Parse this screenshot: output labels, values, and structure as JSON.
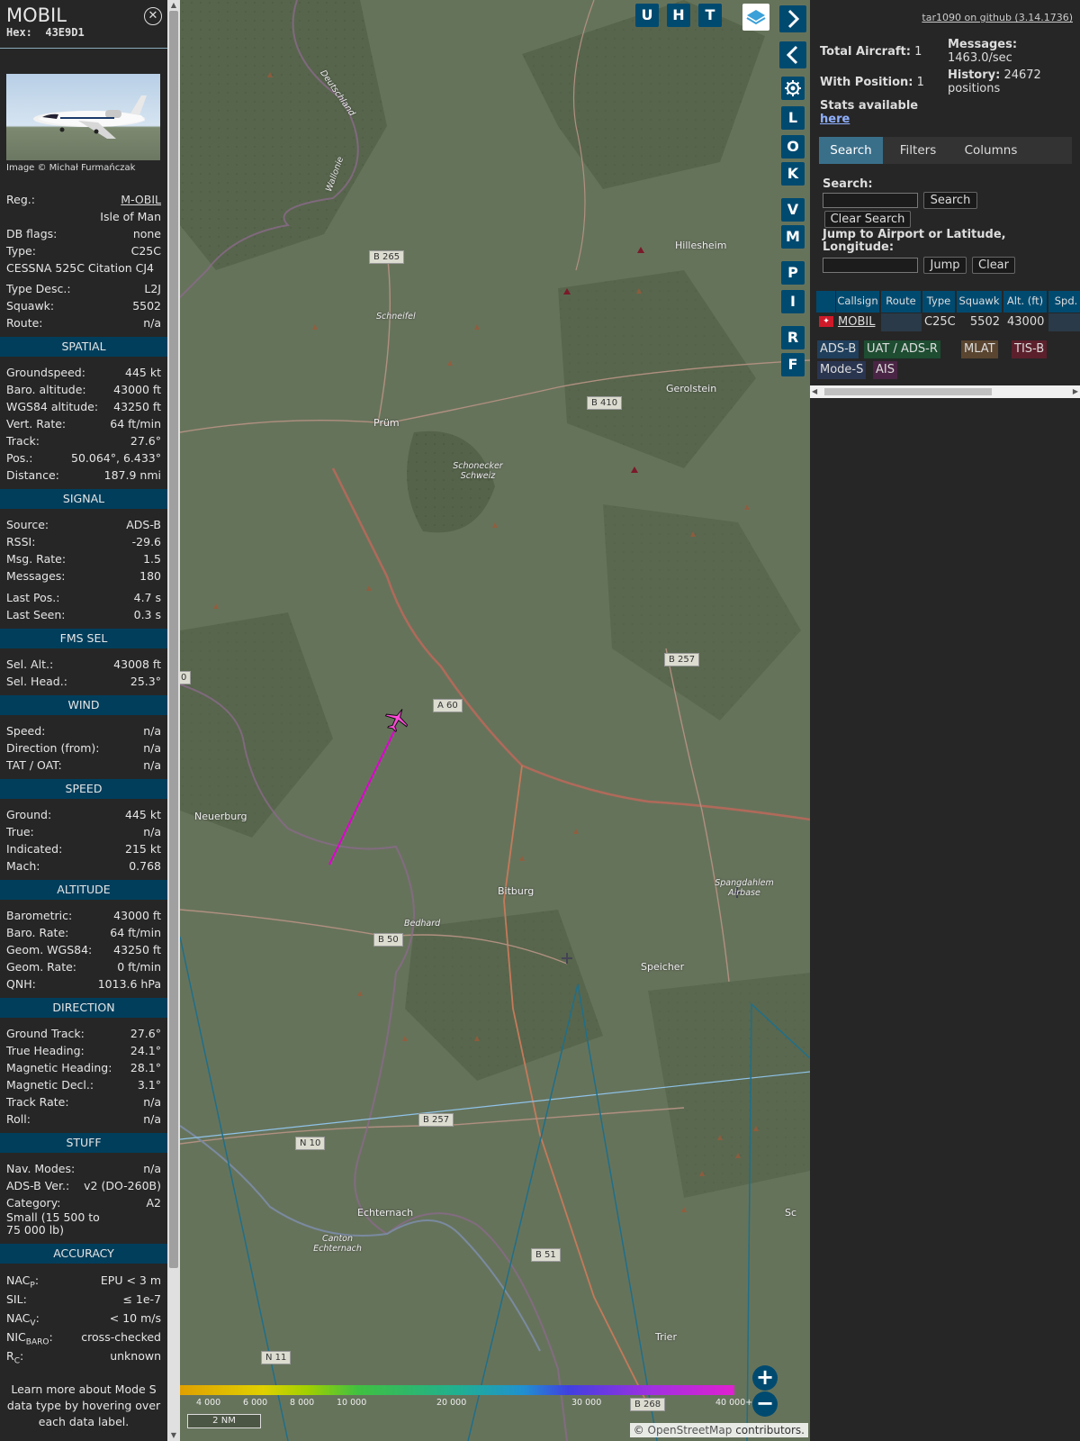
{
  "sidebar": {
    "callsign": "MOBIL",
    "hex_label": "Hex:",
    "hex": "43E9D1",
    "close_icon": "close-icon",
    "photo_credit": "Image © Michał Furmańczak",
    "info": [
      {
        "k": "Reg.:",
        "v": "M-OBIL"
      },
      {
        "k": "",
        "v": "Isle of Man"
      },
      {
        "k": "DB flags:",
        "v": "none"
      },
      {
        "k": "Type:",
        "v": "C25C"
      },
      {
        "k": "CESSNA 525C Citation CJ4",
        "v": ""
      },
      {
        "k": "Type Desc.:",
        "v": "L2J"
      },
      {
        "k": "Squawk:",
        "v": "5502"
      },
      {
        "k": "Route:",
        "v": "n/a"
      }
    ],
    "sections": [
      {
        "title": "SPATIAL",
        "rows": [
          {
            "k": "Groundspeed:",
            "v": "445 kt"
          },
          {
            "k": "Baro. altitude:",
            "v": "43000 ft"
          },
          {
            "k": "WGS84 altitude:",
            "v": "43250 ft"
          },
          {
            "k": "Vert. Rate:",
            "v": "64 ft/min"
          },
          {
            "k": "Track:",
            "v": "27.6°"
          },
          {
            "k": "Pos.:",
            "v": "50.064°, 6.433°"
          },
          {
            "k": "Distance:",
            "v": "187.9 nmi"
          }
        ]
      },
      {
        "title": "SIGNAL",
        "rows": [
          {
            "k": "Source:",
            "v": "ADS-B"
          },
          {
            "k": "RSSI:",
            "v": "-29.6"
          },
          {
            "k": "Msg. Rate:",
            "v": "1.5"
          },
          {
            "k": "Messages:",
            "v": "180"
          },
          {
            "k": "Last Pos.:",
            "v": "4.7 s"
          },
          {
            "k": "Last Seen:",
            "v": "0.3 s"
          }
        ]
      },
      {
        "title": "FMS SEL",
        "rows": [
          {
            "k": "Sel. Alt.:",
            "v": "43008 ft"
          },
          {
            "k": "Sel. Head.:",
            "v": "25.3°"
          }
        ]
      },
      {
        "title": "WIND",
        "rows": [
          {
            "k": "Speed:",
            "v": "n/a"
          },
          {
            "k": "Direction (from):",
            "v": "n/a"
          },
          {
            "k": "TAT / OAT:",
            "v": "n/a"
          }
        ]
      },
      {
        "title": "SPEED",
        "rows": [
          {
            "k": "Ground:",
            "v": "445 kt"
          },
          {
            "k": "True:",
            "v": "n/a"
          },
          {
            "k": "Indicated:",
            "v": "215 kt"
          },
          {
            "k": "Mach:",
            "v": "0.768"
          }
        ]
      },
      {
        "title": "ALTITUDE",
        "rows": [
          {
            "k": "Barometric:",
            "v": "43000 ft"
          },
          {
            "k": "Baro. Rate:",
            "v": "64 ft/min"
          },
          {
            "k": "Geom. WGS84:",
            "v": "43250 ft"
          },
          {
            "k": "Geom. Rate:",
            "v": "0 ft/min"
          },
          {
            "k": "QNH:",
            "v": "1013.6 hPa"
          }
        ]
      },
      {
        "title": "DIRECTION",
        "rows": [
          {
            "k": "Ground Track:",
            "v": "27.6°"
          },
          {
            "k": "True Heading:",
            "v": "24.1°"
          },
          {
            "k": "Magnetic Heading:",
            "v": "28.1°"
          },
          {
            "k": "Magnetic Decl.:",
            "v": "3.1°"
          },
          {
            "k": "Track Rate:",
            "v": "n/a"
          },
          {
            "k": "Roll:",
            "v": "n/a"
          }
        ]
      },
      {
        "title": "STUFF",
        "rows": [
          {
            "k": "Nav. Modes:",
            "v": "n/a"
          },
          {
            "k": "ADS-B Ver.:",
            "v": "v2 (DO-260B)"
          },
          {
            "k": "Category:",
            "v": "A2"
          }
        ]
      }
    ],
    "category_desc_line1": "Small (15 500 to",
    "category_desc_line2": "75 000 lb)",
    "accuracy": {
      "title": "ACCURACY",
      "rows": [
        {
          "k": "NAC",
          "sub": "P",
          "v": "EPU < 3 m"
        },
        {
          "k": "SIL:",
          "sub": "",
          "v": "≤ 1e-7"
        },
        {
          "k": "NAC",
          "sub": "V",
          "v": "< 10 m/s"
        },
        {
          "k": "NIC",
          "sub": "BARO",
          "v": "cross-checked"
        },
        {
          "k": "R",
          "sub": "C",
          "v": "unknown"
        }
      ]
    },
    "footer_line1": "Learn more about Mode S",
    "footer_line2": "data type by hovering over",
    "footer_line3": "each data label."
  },
  "map": {
    "buttons_top": [
      "U",
      "H",
      "T"
    ],
    "buttons_side": [
      "L",
      "O",
      "K",
      "V",
      "M",
      "P",
      "I",
      "R",
      "F"
    ],
    "places": [
      {
        "n": "Prüm",
        "cls": ""
      },
      {
        "n": "Gerolstein",
        "cls": ""
      },
      {
        "n": "Hillesheim",
        "cls": ""
      },
      {
        "n": "Neuerburg",
        "cls": ""
      },
      {
        "n": "Bitburg",
        "cls": ""
      },
      {
        "n": "Speicher",
        "cls": ""
      },
      {
        "n": "Echternach",
        "cls": ""
      },
      {
        "n": "Trier",
        "cls": ""
      },
      {
        "n": "Schneifel",
        "cls": "it"
      },
      {
        "n": "Schonecker Schweiz",
        "cls": "it"
      },
      {
        "n": "Bedhard",
        "cls": "it"
      },
      {
        "n": "Spangdahlem Airbase",
        "cls": "it"
      },
      {
        "n": "Canton Echternach",
        "cls": "it"
      },
      {
        "n": "Wallonie",
        "cls": "it"
      },
      {
        "n": "Deutschland",
        "cls": "it"
      },
      {
        "n": "Sc",
        "cls": ""
      }
    ],
    "road_tags": [
      "B 265",
      "B 410",
      "B 257",
      "A 60",
      "B 50",
      "B 257",
      "N 10",
      "B 51",
      "B 268",
      "N 11",
      "0"
    ],
    "scale_labels": [
      "4 000",
      "6 000",
      "8 000",
      "10 000",
      "20 000",
      "30 000",
      "40 000+"
    ],
    "scale_bar": "2 NM",
    "attribution_prefix": "©",
    "attribution_link": "OpenStreetMap",
    "attribution_suffix": "contributors."
  },
  "panel": {
    "version_link": "tar1090 on github (3.14.1736)",
    "total_aircraft_label": "Total Aircraft:",
    "total_aircraft": "1",
    "with_position_label": "With Position:",
    "with_position": "1",
    "messages_label": "Messages:",
    "messages": "1463.0/sec",
    "history_label": "History:",
    "history": "24672",
    "history_unit": "positions",
    "stats_text": "Stats available",
    "stats_link": "here",
    "tabs": [
      "Search",
      "Filters",
      "Columns"
    ],
    "search_label": "Search:",
    "search_button": "Search",
    "clear_search_button": "Clear Search",
    "jump_label": "Jump to Airport or Latitude, Longitude:",
    "jump_button": "Jump",
    "clear_button": "Clear",
    "columns": [
      "Callsign",
      "Route",
      "Type",
      "Squawk",
      "Alt. (ft)",
      "Spd."
    ],
    "row": {
      "callsign": "MOBIL",
      "route": "",
      "type": "C25C",
      "squawk": "5502",
      "alt": "43000",
      "spd": ""
    },
    "legend": [
      {
        "label": "ADS-B",
        "color": "#1f3f5c"
      },
      {
        "label": "UAT / ADS-R",
        "color": "#1e4d32"
      },
      {
        "label": "MLAT",
        "color": "#5a4530"
      },
      {
        "label": "TIS-B",
        "color": "#5c1f2c"
      },
      {
        "label": "Mode-S",
        "color": "#2a3550"
      },
      {
        "label": "AIS",
        "color": "#4a2545"
      }
    ]
  }
}
